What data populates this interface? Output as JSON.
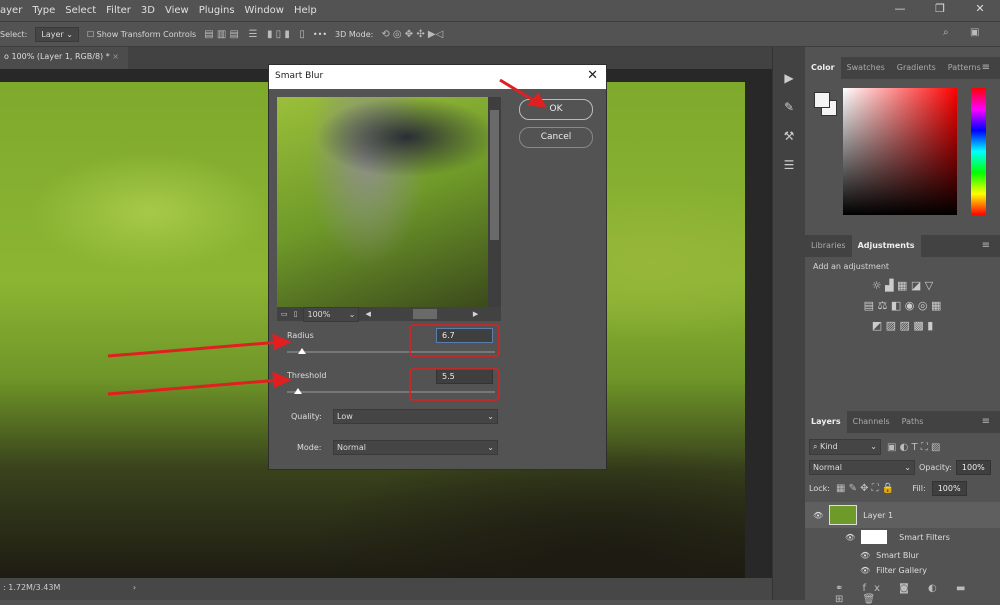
{
  "menubar": {
    "items": [
      "ayer",
      "Type",
      "Select",
      "Filter",
      "3D",
      "View",
      "Plugins",
      "Window",
      "Help"
    ],
    "window_controls": [
      "—",
      "❐",
      "✕"
    ]
  },
  "options": {
    "select_label": "Select:",
    "select_value": "Layer",
    "show_transform": "Show Transform Controls",
    "more": "•••",
    "mode_3d": "3D Mode:"
  },
  "document": {
    "tab": "o 100% (Layer 1, RGB/8) *",
    "tab_close": "×",
    "status": ": 1.72M/3.43M"
  },
  "color_panel": {
    "tabs": [
      "Color",
      "Swatches",
      "Gradients",
      "Patterns"
    ]
  },
  "adjust_panel": {
    "tabs": [
      "Libraries",
      "Adjustments"
    ],
    "hint": "Add an adjustment"
  },
  "layers_panel": {
    "tabs": [
      "Layers",
      "Channels",
      "Paths"
    ],
    "kind": "Kind",
    "blend": "Normal",
    "opacity_label": "Opacity:",
    "opacity": "100%",
    "lock_label": "Lock:",
    "fill_label": "Fill:",
    "fill": "100%",
    "rows": [
      "Layer 1",
      "Smart Filters",
      "Smart Blur",
      "Filter Gallery"
    ]
  },
  "dialog": {
    "title": "Smart Blur",
    "ok": "OK",
    "cancel": "Cancel",
    "zoom": "100%",
    "radius_label": "Radius",
    "radius": "6.7",
    "radius_fraction": 0.07,
    "threshold_label": "Threshold",
    "threshold": "5.5",
    "threshold_fraction": 0.055,
    "quality_label": "Quality:",
    "quality": "Low",
    "mode_label": "Mode:",
    "mode": "Normal"
  },
  "annotation_color": "#e02020"
}
